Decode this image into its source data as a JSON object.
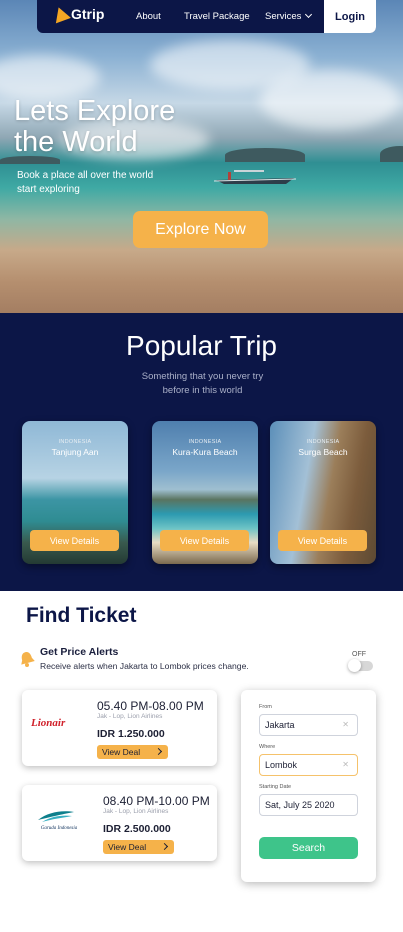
{
  "nav": {
    "brand": "Gtrip",
    "items": [
      {
        "label": "About"
      },
      {
        "label": "Travel Package"
      },
      {
        "label": "Services"
      }
    ],
    "login_label": "Login"
  },
  "hero": {
    "title_line1": "Lets Explore",
    "title_line2": "the World",
    "subtitle": "Book a place all over the world start exploring",
    "cta_label": "Explore Now"
  },
  "popular": {
    "title": "Popular Trip",
    "subtitle": "Something that you never try before in this world",
    "trips": [
      {
        "country": "INDONESIA",
        "name": "Tanjung Aan",
        "button": "View Details"
      },
      {
        "country": "INDONESIA",
        "name": "Kura-Kura Beach",
        "button": "View Details"
      },
      {
        "country": "INDONESIA",
        "name": "Surga Beach",
        "button": "View Details"
      }
    ]
  },
  "find_ticket": {
    "title": "Find Ticket",
    "alert_title": "Get Price Alerts",
    "alert_sub": "Receive alerts when Jakarta to Lombok prices change.",
    "toggle_state": "OFF",
    "flights": [
      {
        "airline": "Lion Air",
        "logo_text": "Lion",
        "logo_text2": "air",
        "time": "05.40 PM-08.00 PM",
        "route": "Jak - Lop, Lion Airlines",
        "price": "IDR 1.250.000",
        "deal": "View Deal"
      },
      {
        "airline": "Garuda Indonesia",
        "logo_text": "Garuda Indonesia",
        "time": "08.40 PM-10.00 PM",
        "route": "Jak - Lop, Lion Airlines",
        "price": "IDR 2.500.000",
        "deal": "View Deal"
      }
    ],
    "search": {
      "from_label": "From",
      "from_value": "Jakarta",
      "where_label": "Where",
      "where_value": "Lombok",
      "date_label": "Starting Date",
      "date_value": "Sat, July 25 2020",
      "button": "Search"
    }
  },
  "colors": {
    "navy": "#0c1647",
    "accent": "#f5b24a",
    "search_green": "#3ec48a"
  }
}
